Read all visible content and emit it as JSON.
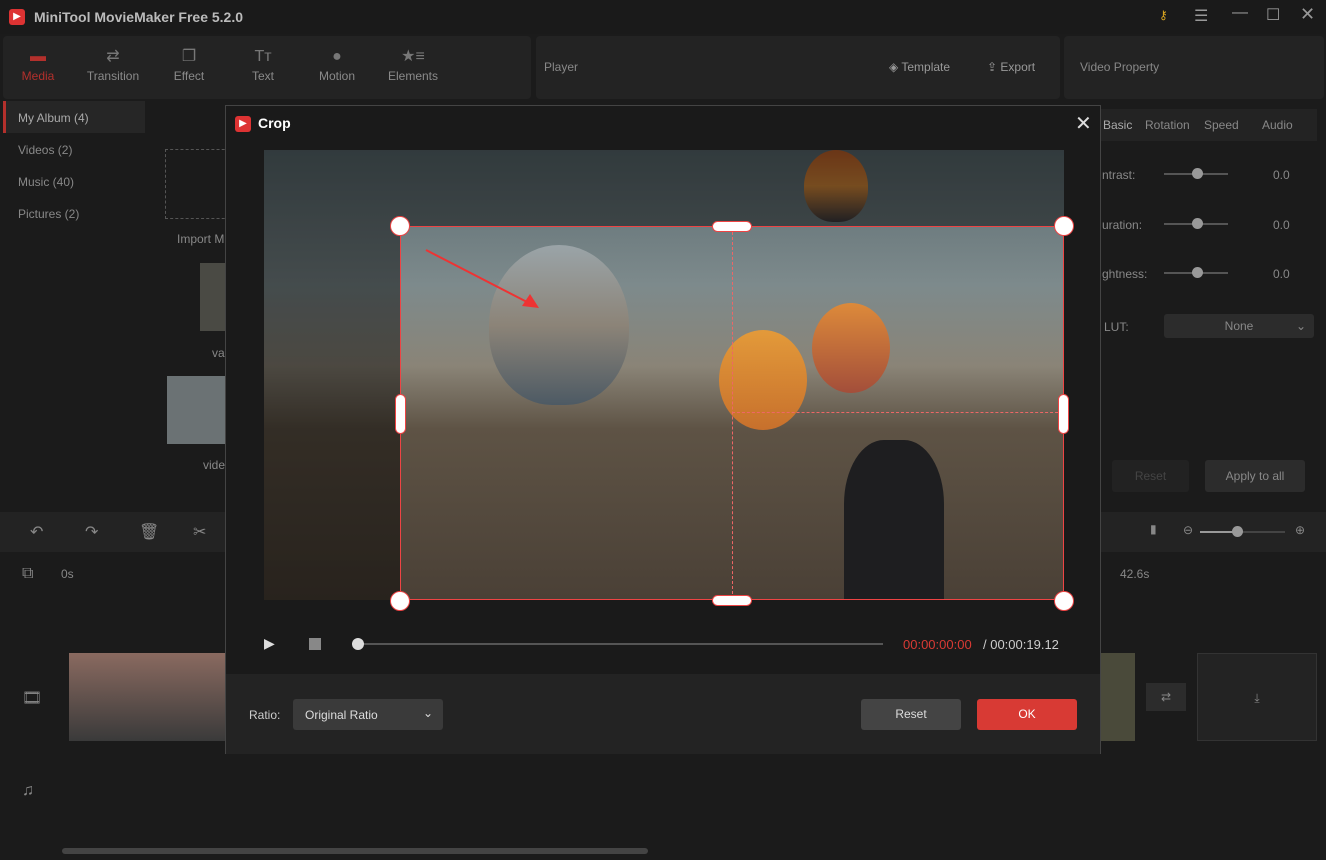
{
  "app": {
    "title": "MiniTool MovieMaker Free 5.2.0"
  },
  "toolbar": {
    "tabs": [
      {
        "label": "Media",
        "icon": "folder-icon",
        "active": true
      },
      {
        "label": "Transition",
        "icon": "swap-icon"
      },
      {
        "label": "Effect",
        "icon": "effect-icon"
      },
      {
        "label": "Text",
        "icon": "text-icon"
      },
      {
        "label": "Motion",
        "icon": "motion-icon"
      },
      {
        "label": "Elements",
        "icon": "elements-icon"
      }
    ]
  },
  "player": {
    "label": "Player",
    "template": "Template",
    "export": "Export"
  },
  "property": {
    "label": "Video Property",
    "tabs": [
      "Basic",
      "Rotation",
      "Speed",
      "Audio"
    ],
    "sliders": [
      {
        "label": "ntrast:",
        "value": "0.0"
      },
      {
        "label": "uration:",
        "value": "0.0"
      },
      {
        "label": "ghtness:",
        "value": "0.0"
      }
    ],
    "lut_label": "LUT:",
    "lut_value": "None",
    "reset": "Reset",
    "apply_all": "Apply to all"
  },
  "sidebar": {
    "items": [
      "My Album (4)",
      "Videos (2)",
      "Music (40)",
      "Pictures (2)"
    ]
  },
  "media": {
    "import": "Import M",
    "items": [
      "va",
      "vide"
    ]
  },
  "timeline": {
    "start": "0s",
    "end": "42.6s"
  },
  "dialog": {
    "title": "Crop",
    "time_current": "00:00:00:00",
    "time_total": "/ 00:00:19.12",
    "ratio_label": "Ratio:",
    "ratio_value": "Original Ratio",
    "reset": "Reset",
    "ok": "OK",
    "accent": "#d83a34"
  }
}
